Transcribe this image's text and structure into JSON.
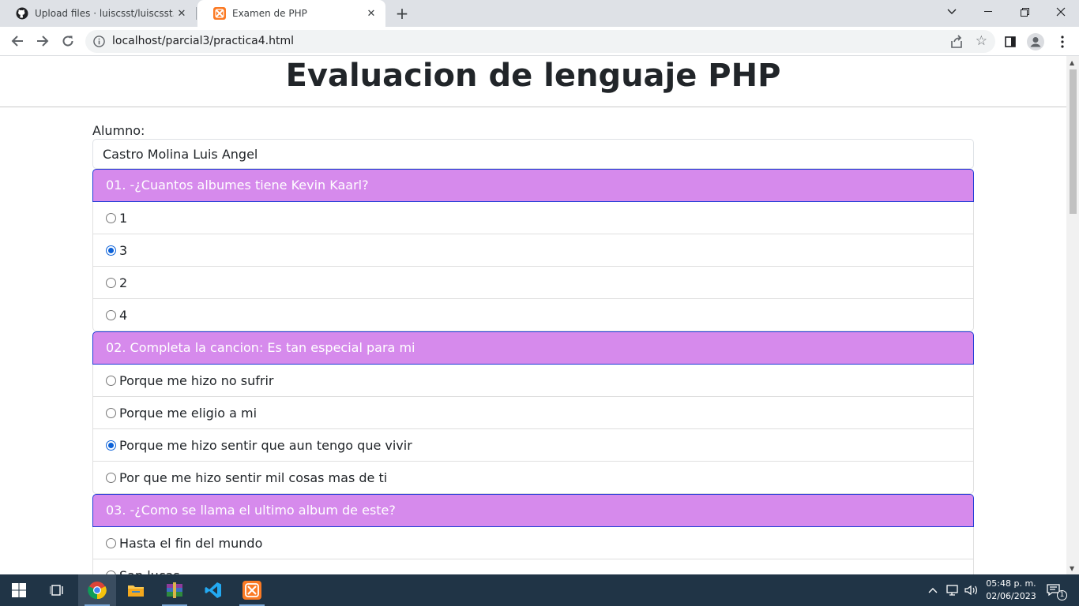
{
  "browser": {
    "tabs": [
      {
        "title": "Upload files · luiscsst/luiscsst.gith",
        "icon": "github-icon",
        "active": false
      },
      {
        "title": "Examen de PHP",
        "icon": "xampp-icon",
        "active": true
      }
    ],
    "url": "localhost/parcial3/practica4.html"
  },
  "page": {
    "title": "Evaluacion de lenguaje PHP",
    "alumno_label": "Alumno:",
    "alumno_value": "Castro Molina Luis Angel",
    "header_color": "#d68aec",
    "questions": [
      {
        "text": "01. -¿Cuantos albumes tiene Kevin Kaarl?",
        "options": [
          "1",
          "3",
          "2",
          "4"
        ],
        "selected": 1
      },
      {
        "text": "02. Completa la cancion: Es tan especial para mi",
        "options": [
          "Porque me hizo no sufrir",
          "Porque me eligio a mi",
          "Porque me hizo sentir que aun tengo que vivir",
          "Por que me hizo sentir mil cosas mas de ti"
        ],
        "selected": 2
      },
      {
        "text": "03. -¿Como se llama el ultimo album de este?",
        "options": [
          "Hasta el fin del mundo",
          "San lucas"
        ],
        "selected": -1
      }
    ]
  },
  "taskbar": {
    "time": "05:48 p. m.",
    "date": "02/06/2023",
    "notification_count": "1"
  }
}
